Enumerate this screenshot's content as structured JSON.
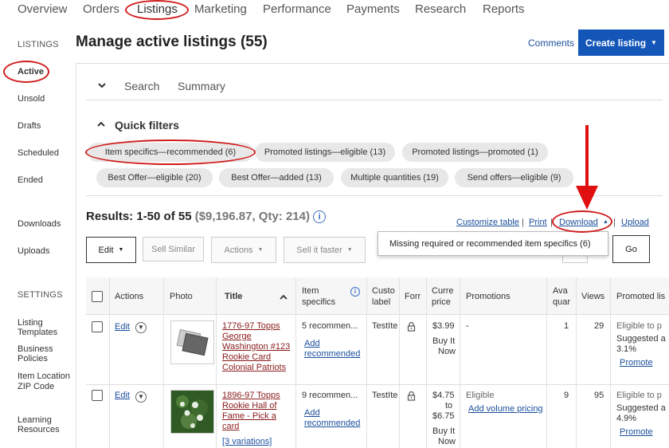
{
  "nav": [
    "Overview",
    "Orders",
    "Listings",
    "Marketing",
    "Performance",
    "Payments",
    "Research",
    "Reports"
  ],
  "sidebar": {
    "listings_head": "LISTINGS",
    "items": [
      "Active",
      "Unsold",
      "Drafts",
      "Scheduled",
      "Ended"
    ],
    "downloads": "Downloads",
    "uploads": "Uploads",
    "settings_head": "SETTINGS",
    "settings": [
      [
        "Listing",
        "Templates"
      ],
      [
        "Business",
        "Policies"
      ],
      [
        "Item Location",
        "ZIP Code"
      ],
      [
        "Learning",
        "Resources"
      ]
    ]
  },
  "header": {
    "title": "Manage active listings (55)",
    "comments": "Comments",
    "create": "Create listing"
  },
  "tabs": [
    "Search",
    "Summary"
  ],
  "quick_filters": {
    "title": "Quick filters",
    "pills": [
      "Item specifics—recommended (6)",
      "Promoted listings—eligible (13)",
      "Promoted listings—promoted (1)",
      "Best Offer—eligible (20)",
      "Best Offer—added (13)",
      "Multiple quantities (19)",
      "Send offers—eligible (9)"
    ]
  },
  "results": {
    "main": "Results: 1-50 of 55",
    "sub": "($9,196.87, Qty: 214)",
    "info": "i"
  },
  "links": {
    "customize": "Customize table",
    "print": "Print",
    "download": "Download",
    "upload": "Upload",
    "sep": "|"
  },
  "toolbar": {
    "edit": "Edit",
    "sell_similar": "Sell Similar",
    "actions": "Actions",
    "sell_faster": "Sell it faster",
    "go": "Go"
  },
  "dropdown": {
    "option": "Missing required or recommended item specifics (6)"
  },
  "table": {
    "headers": {
      "actions": "Actions",
      "photo": "Photo",
      "title": "Title",
      "specifics": [
        "Item",
        "specifics"
      ],
      "custom": [
        "Custo",
        "label"
      ],
      "format": "Forr",
      "price": [
        "Curre",
        "price"
      ],
      "promotions": "Promotions",
      "available": [
        "Ava",
        "quar"
      ],
      "views": "Views",
      "promoted": "Promoted lis"
    },
    "rows": [
      {
        "edit": "Edit",
        "title": [
          "1776-97 Topps",
          "George",
          "Washington #123",
          "Rookie Card",
          "Colonial Patriots"
        ],
        "specifics": "5 recommen...",
        "add_rec": [
          "Add",
          "recommended"
        ],
        "custom": "TestIte",
        "price": [
          "$3.99",
          "Buy It",
          "Now"
        ],
        "promotions": "-",
        "available": "1",
        "views": "29",
        "promoted": [
          "Eligible to p",
          "Suggested a",
          "3.1%"
        ],
        "promote": "Promote"
      },
      {
        "edit": "Edit",
        "title": [
          "1896-97 Topps",
          "Rookie Hall of",
          "Fame - Pick a",
          "card"
        ],
        "variations": "[3 variations]",
        "specifics": "9 recommen...",
        "add_rec": [
          "Add",
          "recommended"
        ],
        "custom": "TestIte",
        "price": [
          "$4.75",
          "to",
          "$6.75",
          "Buy It",
          "Now"
        ],
        "promotions": "Eligible",
        "volume": "Add volume pricing",
        "available": "9",
        "views": "95",
        "promoted": [
          "Eligible to p",
          "Suggested a",
          "4.9%"
        ],
        "promote": "Promote"
      }
    ]
  },
  "colors": {
    "primary_button": "#1456b8",
    "annotation": "#d01c1c",
    "link": "#1a4f9c",
    "title_link": "#8a1a1a"
  }
}
